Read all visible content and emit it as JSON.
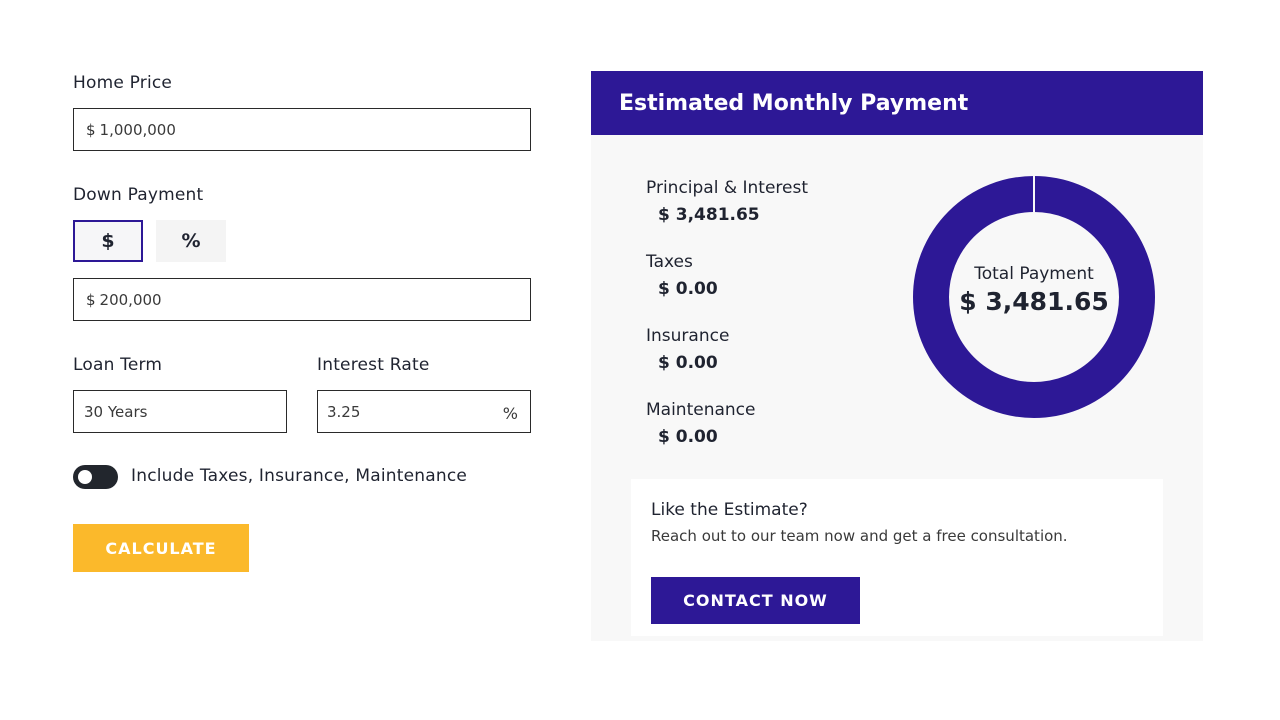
{
  "form": {
    "home_price_label": "Home Price",
    "home_price_currency": "$",
    "home_price_value": "1,000,000",
    "down_payment_label": "Down Payment",
    "down_payment_mode_dollar": "$",
    "down_payment_mode_percent": "%",
    "down_payment_currency": "$",
    "down_payment_value": "200,000",
    "loan_term_label": "Loan Term",
    "loan_term_value": "30 Years",
    "interest_rate_label": "Interest Rate",
    "interest_rate_value": "3.25",
    "interest_rate_unit": "%",
    "toggle_label": "Include Taxes, Insurance, Maintenance",
    "toggle_on": false,
    "calculate_label": "CALCULATE"
  },
  "panel": {
    "title": "Estimated Monthly Payment",
    "breakdown": [
      {
        "label": "Principal & Interest",
        "value": "$ 3,481.65"
      },
      {
        "label": "Taxes",
        "value": "$ 0.00"
      },
      {
        "label": "Insurance",
        "value": "$ 0.00"
      },
      {
        "label": "Maintenance",
        "value": "$ 0.00"
      }
    ],
    "total_label": "Total Payment",
    "total_value": "$ 3,481.65",
    "cta_title": "Like the Estimate?",
    "cta_text": "Reach out to our team now and get a free consultation.",
    "contact_label": "CONTACT NOW"
  },
  "colors": {
    "primary": "#2d1896",
    "accent": "#fbb92b",
    "toggle": "#22262d"
  }
}
